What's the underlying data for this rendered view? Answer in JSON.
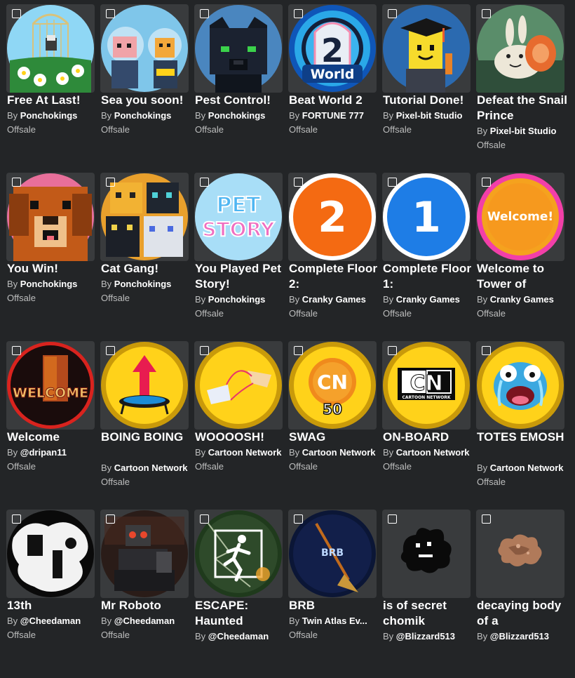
{
  "by_prefix": "By",
  "rows": [
    [
      {
        "name": "Free At Last!",
        "creator": "Ponchokings",
        "price": "Offsale",
        "icon": "birdcage-flowers-icon"
      },
      {
        "name": "Sea you soon!",
        "creator": "Ponchokings",
        "price": "Offsale",
        "icon": "diving-characters-icon"
      },
      {
        "name": "Pest Control!",
        "creator": "Ponchokings",
        "price": "Offsale",
        "icon": "black-panther-icon"
      },
      {
        "name": "Beat World 2",
        "creator": "FORTUNE 777",
        "price": "Offsale",
        "icon": "world-2-emblem-icon",
        "badge_text": "2",
        "badge_sub": "World"
      },
      {
        "name": "Tutorial Done!",
        "creator": "Pixel-bit Studio",
        "price": "Offsale",
        "icon": "graduate-character-icon"
      },
      {
        "name": "Defeat the Snail Prince",
        "creator": "Pixel-bit Studio",
        "price": "Offsale",
        "icon": "snail-prince-icon"
      }
    ],
    [
      {
        "name": "You Win!",
        "creator": "Ponchokings",
        "price": "Offsale",
        "icon": "dog-face-icon"
      },
      {
        "name": "Cat Gang!",
        "creator": "Ponchokings",
        "price": "Offsale",
        "icon": "cat-gang-icon"
      },
      {
        "name": "You Played Pet Story!",
        "creator": "Ponchokings",
        "price": "Offsale",
        "icon": "pet-story-logo-icon",
        "logo_top": "PET",
        "logo_bottom": "STORY"
      },
      {
        "name": "Complete Floor 2:",
        "creator": "Cranky Games",
        "price": "Offsale",
        "icon": "number-2-badge-icon",
        "number": "2"
      },
      {
        "name": "Complete Floor 1:",
        "creator": "Cranky Games",
        "price": "Offsale",
        "icon": "number-1-badge-icon",
        "number": "1"
      },
      {
        "name": "Welcome to Tower of",
        "creator": "Cranky Games",
        "price": "Offsale",
        "icon": "welcome-badge-icon",
        "badge_text": "Welcome!"
      }
    ],
    [
      {
        "name": "Welcome",
        "creator": "@dripan11",
        "price": "Offsale",
        "icon": "welcome-door-icon",
        "badge_text": "WELCOME"
      },
      {
        "name": "BOING BOING",
        "creator": "Cartoon Network",
        "price": "Offsale",
        "icon": "trampoline-arrow-icon"
      },
      {
        "name": "WOOOOSH!",
        "creator": "Cartoon Network",
        "price": "Offsale",
        "icon": "zipline-icon"
      },
      {
        "name": "SWAG",
        "creator": "Cartoon Network",
        "price": "Offsale",
        "icon": "cn-coin-icon",
        "coin_text": "CN",
        "coin_num": "50"
      },
      {
        "name": "ON-BOARD",
        "creator": "Cartoon Network",
        "price": "Offsale",
        "icon": "cartoon-network-logo-icon",
        "logo_text": "CN",
        "logo_sub": "CARTOON NETWORK"
      },
      {
        "name": "TOTES EMOSH",
        "creator": "Cartoon Network",
        "price": "Offsale",
        "icon": "crying-cat-face-icon"
      }
    ],
    [
      {
        "name": "13th",
        "creator": "@Cheedaman",
        "price": "Offsale",
        "icon": "ghost-silhouette-icon"
      },
      {
        "name": "Mr Roboto",
        "creator": "@Cheedaman",
        "price": "Offsale",
        "icon": "robot-figure-icon"
      },
      {
        "name": "ESCAPE: Haunted",
        "creator": "@Cheedaman",
        "price": "",
        "icon": "running-man-escape-icon"
      },
      {
        "name": "BRB",
        "creator": "Twin Atlas Ev...",
        "price": "Offsale",
        "icon": "brb-broom-icon",
        "badge_text": "BRB"
      },
      {
        "name": "is of secret chomik",
        "creator": "@Blizzard513",
        "price": "",
        "icon": "black-blob-icon"
      },
      {
        "name": "decaying body of a",
        "creator": "@Blizzard513",
        "price": "",
        "icon": "decaying-blob-icon"
      }
    ]
  ]
}
